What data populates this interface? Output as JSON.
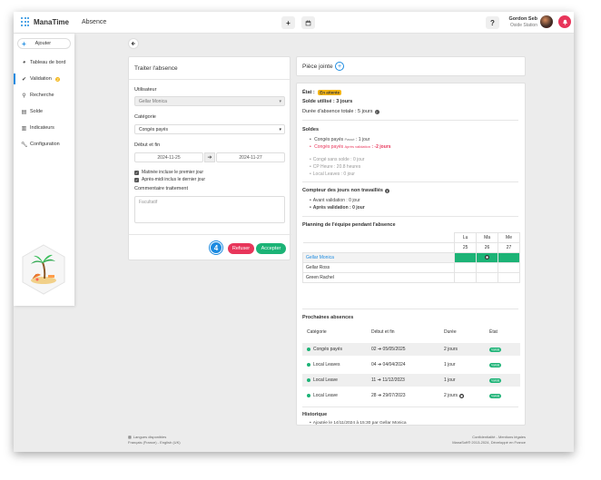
{
  "app": {
    "name": "ManaTime",
    "page_title": "Absence"
  },
  "header": {
    "plus_label": "+",
    "calendar_icon": "calendar-icon",
    "help_label": "?",
    "user_name": "Gordon Seb",
    "user_subtitle": "Oside Station"
  },
  "sidebar": {
    "add_label": "Ajouter",
    "items": [
      {
        "label": "Tableau de bord",
        "icon": "dashboard-icon"
      },
      {
        "label": "Validation",
        "badge": "2",
        "icon": "check-icon"
      },
      {
        "label": "Recherche",
        "icon": "search-icon"
      },
      {
        "label": "Solde",
        "icon": "balance-icon"
      },
      {
        "label": "Indicateurs",
        "icon": "chart-icon"
      },
      {
        "label": "Configuration",
        "icon": "wrench-icon"
      }
    ]
  },
  "form": {
    "title": "Traiter l'absence",
    "user_label": "Utilisateur",
    "user_value": "Gellar Monica",
    "category_label": "Catégorie",
    "category_value": "Congés payés",
    "dates_label": "Début et fin",
    "start_date": "2024-11-25",
    "end_date": "2024-11-27",
    "check_morning": "Matinée incluse le premier jour",
    "check_afternoon": "Après-midi inclus le dernier jour",
    "comment_label": "Commentaire traitement",
    "comment_placeholder": "Facultatif",
    "step_number": "4",
    "refuse_label": "Refuser",
    "accept_label": "Accepter"
  },
  "attachment": {
    "title": "Pièce jointe",
    "add_label": "+"
  },
  "details": {
    "state_label": "État :",
    "state_value": "En attente",
    "balance_used": "Solde utilisé : 3 jours",
    "total_duration": "Durée d'absence totale : 5 jours",
    "balances_title": "Soldes",
    "balances": [
      {
        "label": "Congés payés",
        "tag": "Passé",
        "value": " : 1 jour"
      },
      {
        "label": "Congés payés",
        "tag": "Après validation",
        "value": " : -2 jours"
      },
      {
        "label": "Congé sans solde : 0 jour"
      },
      {
        "label": "CP Heure : 20.8 heures"
      },
      {
        "label": "Local Leaves : 0 jour"
      }
    ],
    "counter_title": "Compteur des jours non travaillés",
    "counter_before": "Avant validation : 0 jour",
    "counter_after": "Après validation : 0 jour",
    "planning_title": "Planning de l'équipe pendant l'absence",
    "planning_days": [
      "Lu",
      "Ma",
      "Me"
    ],
    "planning_dates": [
      "25",
      "26",
      "27"
    ],
    "planning_people": [
      "Gellar Monica",
      "Gellar Ross",
      "Green Rachel"
    ],
    "upcoming_title": "Prochaines absences",
    "upcoming_headers": [
      "Catégorie",
      "Début et fin",
      "Durée",
      "État"
    ],
    "upcoming_rows": [
      {
        "category": "Congés payés",
        "start": "02",
        "end": "05/05/2025",
        "duration": "2 jours",
        "state": "Validé"
      },
      {
        "category": "Local Leaves",
        "start": "04",
        "end": "04/04/2024",
        "duration": "1 jour",
        "state": "Validé"
      },
      {
        "category": "Local Leave",
        "start": "11",
        "end": "11/12/2023",
        "duration": "1 jour",
        "state": "Validé"
      },
      {
        "category": "Local Leave",
        "start": "28",
        "end": "29/07/2023",
        "duration": "2 jours",
        "state": "Validé"
      }
    ],
    "history_title": "Historique",
    "history_item": "Ajoutée le 14/11/2024 à 15:30 par Gellar Monica"
  },
  "footer": {
    "languages_title": "Langues disponibles",
    "languages": "Français (France) - English (UK)",
    "legal": "Confidentialité - Mentions légales",
    "copyright": "ManaSoft® 2013-2024, Développé en France"
  },
  "colors": {
    "accent": "#1d8be0",
    "green": "#1cb376",
    "red": "#e8355a",
    "warning": "#f3b516"
  }
}
